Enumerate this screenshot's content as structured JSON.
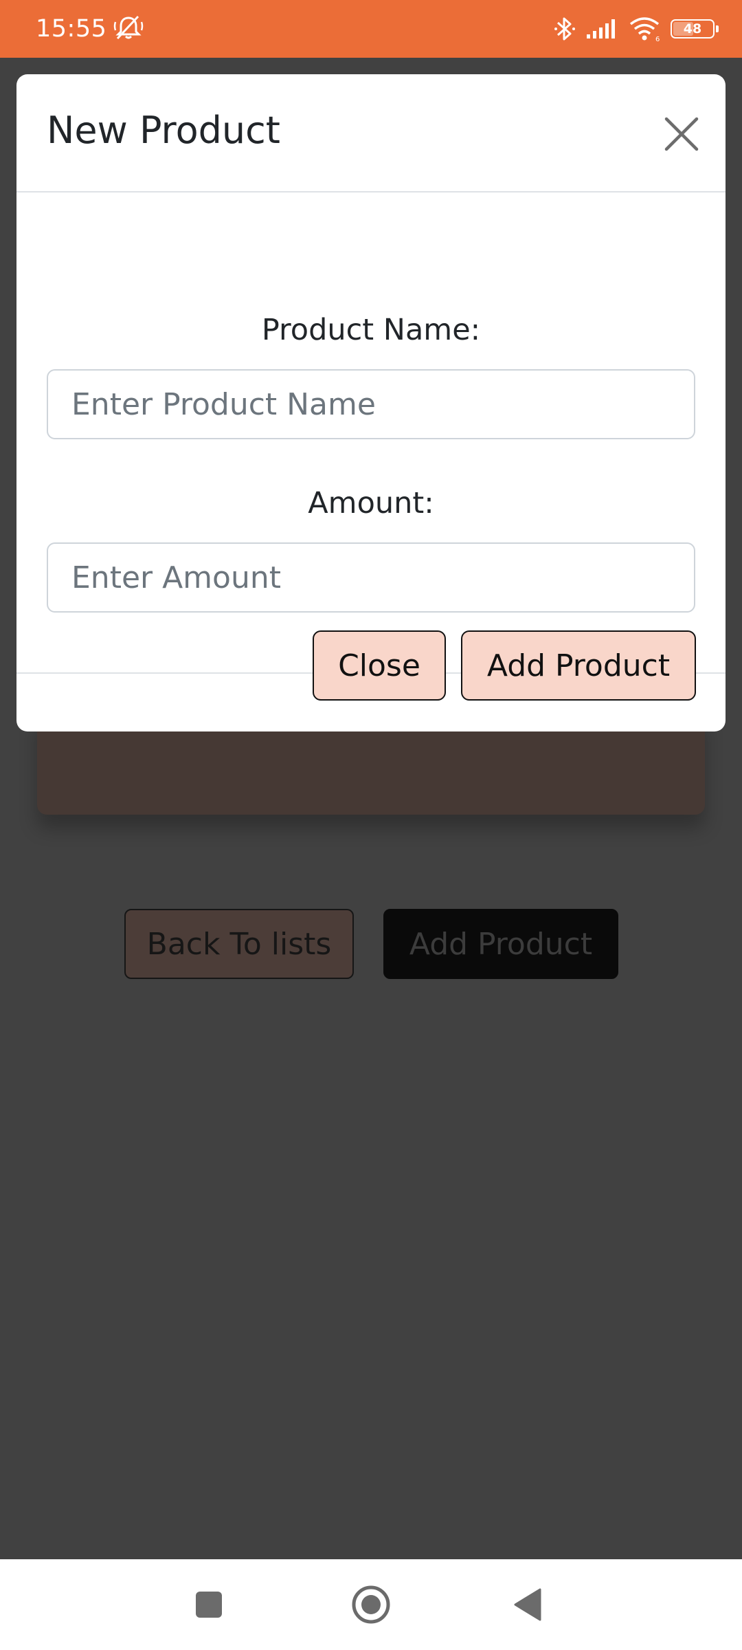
{
  "status_bar": {
    "time": "15:55",
    "battery_level": "48",
    "background_color": "#EB6D37",
    "icons": [
      "bell-off-icon",
      "bluetooth-icon",
      "signal-icon",
      "wifi-icon",
      "battery-icon"
    ]
  },
  "background_page": {
    "back_button_label": "Back To lists",
    "add_button_label": "Add Product"
  },
  "modal": {
    "title": "New Product",
    "close_icon": "close-icon",
    "fields": {
      "product_name": {
        "label": "Product Name:",
        "placeholder": "Enter Product Name",
        "value": ""
      },
      "amount": {
        "label": "Amount:",
        "placeholder": "Enter Amount",
        "value": ""
      }
    },
    "footer": {
      "close_label": "Close",
      "add_label": "Add Product",
      "button_color": "#F9D6CA"
    }
  },
  "nav_bar": {
    "items": [
      "recents-icon",
      "home-icon",
      "back-icon"
    ]
  },
  "colors": {
    "accent": "#EB6D37",
    "overlay": "#414141"
  }
}
